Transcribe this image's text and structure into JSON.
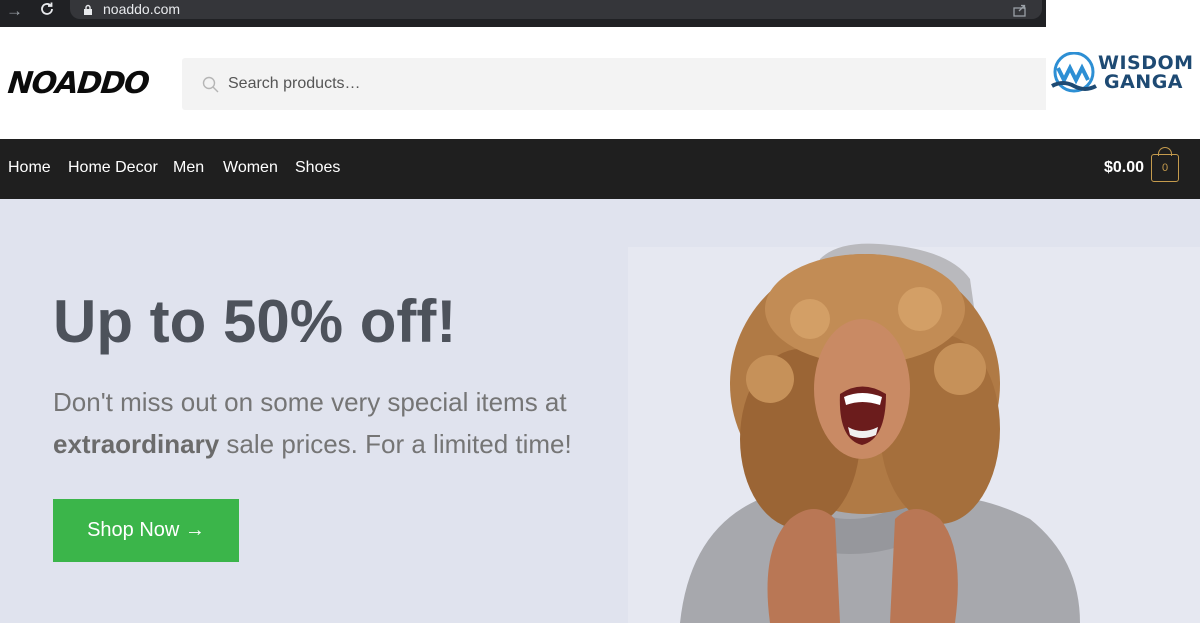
{
  "browser": {
    "url": "noaddo.com",
    "icons": [
      "forward-arrow-icon",
      "reload-icon",
      "lock-icon",
      "share-icon"
    ]
  },
  "header": {
    "logo_text": "NOADDO",
    "search": {
      "placeholder": "Search products…",
      "value": ""
    }
  },
  "watermark": {
    "line1": "WISDOM",
    "line2": "GANGA"
  },
  "nav": {
    "items": [
      {
        "label": "Home"
      },
      {
        "label": "Home Decor"
      },
      {
        "label": "Men"
      },
      {
        "label": "Women"
      },
      {
        "label": "Shoes"
      }
    ],
    "cart": {
      "amount": "$0.00",
      "count": "0"
    }
  },
  "hero": {
    "title": "Up to 50% off!",
    "text_part1": "Don't miss out on some very special items at ",
    "text_bold": "extraordinary",
    "text_part2": " sale prices. For a limited time!",
    "button_label": "Shop Now →"
  },
  "colors": {
    "nav_bg": "#1f1f1f",
    "hero_bg": "#e0e3ee",
    "button_bg": "#3bb54a",
    "cart_accent": "#c59b4d",
    "heading": "#4d525b"
  }
}
